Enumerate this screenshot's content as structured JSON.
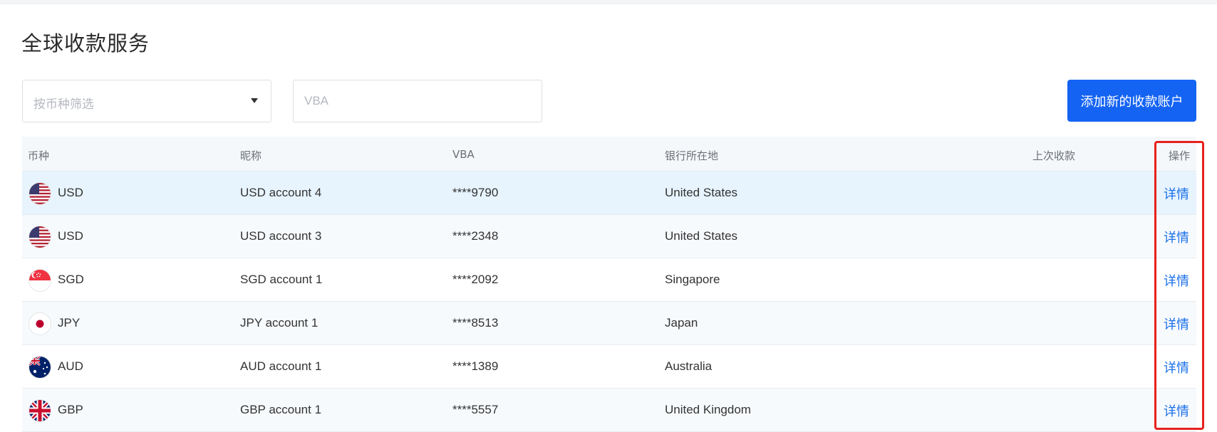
{
  "page": {
    "title": "全球收款服务"
  },
  "filters": {
    "currency_placeholder": "按币种筛选",
    "vba_placeholder": "VBA",
    "vba_value": ""
  },
  "actions": {
    "add_account_label": "添加新的收款账户"
  },
  "table": {
    "headers": {
      "currency": "币种",
      "nickname": "昵称",
      "vba": "VBA",
      "bank_location": "银行所在地",
      "last_receipt": "上次收款",
      "operation": "操作"
    },
    "rows": [
      {
        "flag": "us-flag-icon",
        "currency": "USD",
        "nickname": "USD account 4",
        "vba": "****9790",
        "bank_location": "United States",
        "last_receipt": "",
        "action": "详情"
      },
      {
        "flag": "us-flag-icon",
        "currency": "USD",
        "nickname": "USD account 3",
        "vba": "****2348",
        "bank_location": "United States",
        "last_receipt": "",
        "action": "详情"
      },
      {
        "flag": "sg-flag-icon",
        "currency": "SGD",
        "nickname": "SGD account 1",
        "vba": "****2092",
        "bank_location": "Singapore",
        "last_receipt": "",
        "action": "详情"
      },
      {
        "flag": "jp-flag-icon",
        "currency": "JPY",
        "nickname": "JPY account 1",
        "vba": "****8513",
        "bank_location": "Japan",
        "last_receipt": "",
        "action": "详情"
      },
      {
        "flag": "au-flag-icon",
        "currency": "AUD",
        "nickname": "AUD account 1",
        "vba": "****1389",
        "bank_location": "Australia",
        "last_receipt": "",
        "action": "详情"
      },
      {
        "flag": "gb-flag-icon",
        "currency": "GBP",
        "nickname": "GBP account 1",
        "vba": "****5557",
        "bank_location": "United Kingdom",
        "last_receipt": "",
        "action": "详情"
      }
    ]
  },
  "colors": {
    "primary": "#1463f3",
    "link": "#1a6fe8",
    "highlight_border": "#e8211d",
    "hovered_row": "#e7f4fe"
  }
}
